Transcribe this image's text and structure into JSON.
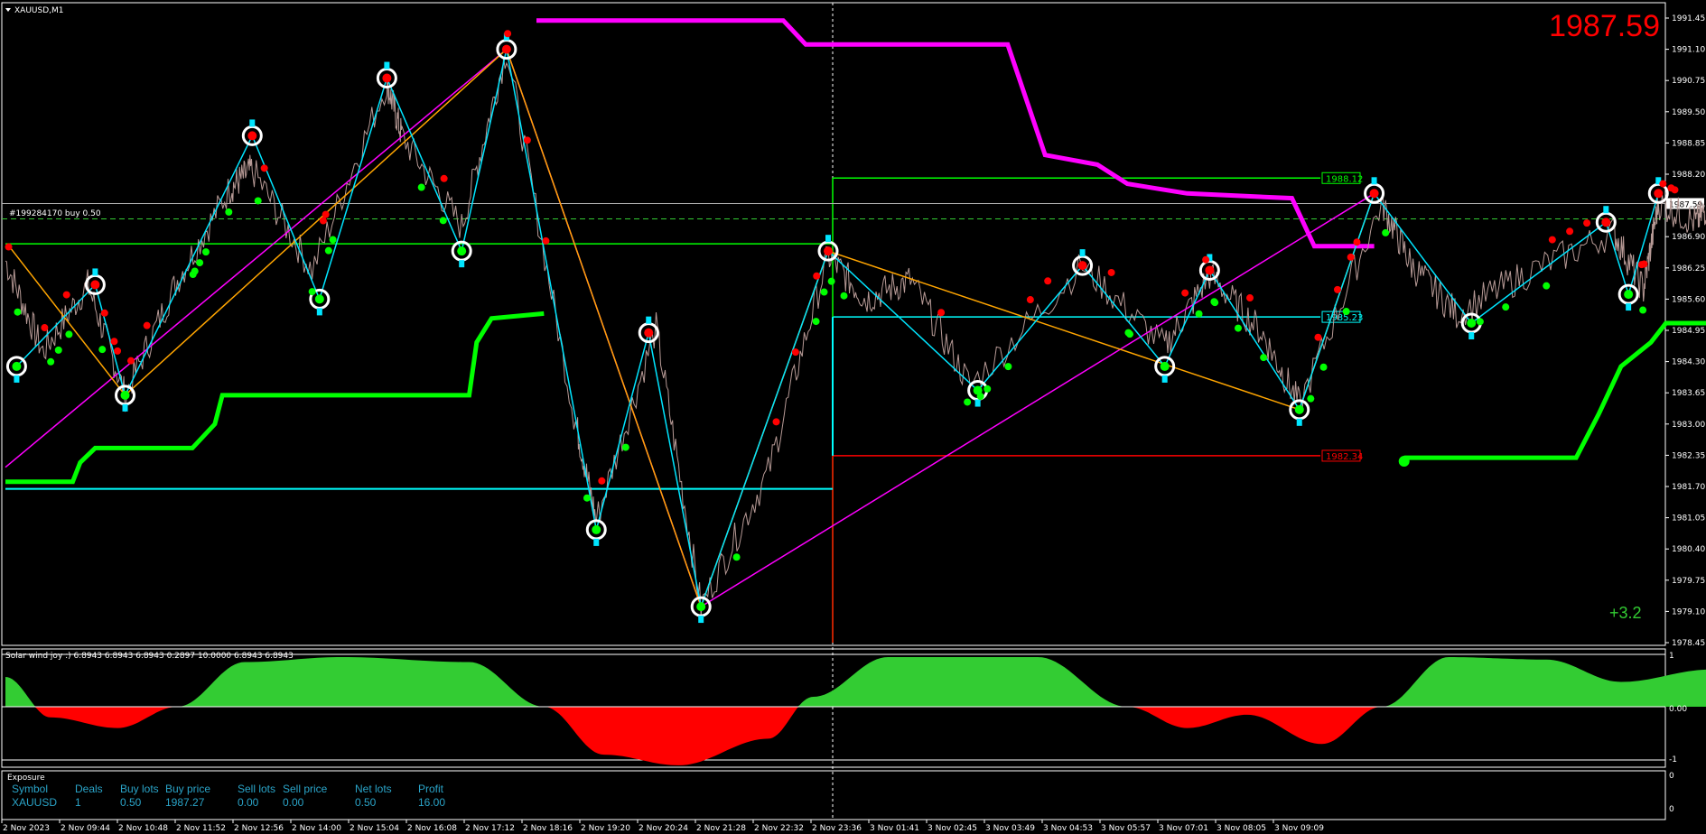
{
  "window": {
    "symbol_title": "XAUUSD,M1"
  },
  "price_display": "1987.59",
  "order_label": "#199284170 buy 0.50",
  "profit_display": "+3.2",
  "levels": {
    "green": {
      "label": "1988.12",
      "value": 1988.12,
      "color": "#00ff00"
    },
    "cyan": {
      "label": "1985.23",
      "value": 1985.23,
      "color": "#00ffff"
    },
    "red": {
      "label": "1982.34",
      "value": 1982.34,
      "color": "#ff0000"
    },
    "current": {
      "label": "1987.59",
      "value": 1987.59
    }
  },
  "indicator": {
    "title": "Solar wind joy :) 6.8943 6.8943 6.8943 0.2897 10.0000 6.8943 6.8943"
  },
  "indicator_axis": [
    "1",
    "0.00",
    "-1"
  ],
  "exposure": {
    "title": "Exposure",
    "headers": [
      "Symbol",
      "Deals",
      "Buy lots",
      "Buy price",
      "Sell lots",
      "Sell price",
      "Net lots",
      "Profit"
    ],
    "row": [
      "XAUUSD",
      "1",
      "0.50",
      "1987.27",
      "0.00",
      "0.00",
      "0.50",
      "16.00"
    ]
  },
  "exposure_axis": [
    "0",
    "0"
  ],
  "colors": {
    "price_line": "#b79a96",
    "magenta": "#ff00ff",
    "orange": "#ffa500",
    "cyan": "#00e5ff",
    "green": "#00ff00",
    "red": "#ff0000",
    "osc_pos": "#33cc33",
    "osc_neg": "#ff0000"
  },
  "chart_data": {
    "type": "line",
    "title": "XAUUSD,M1",
    "xlabels": [
      "2 Nov 2023",
      "2 Nov 09:44",
      "2 Nov 10:48",
      "2 Nov 11:52",
      "2 Nov 12:56",
      "2 Nov 14:00",
      "2 Nov 15:04",
      "2 Nov 16:08",
      "2 Nov 17:12",
      "2 Nov 18:16",
      "2 Nov 19:20",
      "2 Nov 20:24",
      "2 Nov 21:28",
      "2 Nov 22:32",
      "2 Nov 23:36",
      "3 Nov 01:41",
      "3 Nov 02:45",
      "3 Nov 03:49",
      "3 Nov 04:53",
      "3 Nov 05:57",
      "3 Nov 07:01",
      "3 Nov 08:05",
      "3 Nov 09:09"
    ],
    "yticks": [
      "1991.45",
      "1991.10",
      "1990.75",
      "1989.50",
      "1988.85",
      "1988.20",
      "1987.55",
      "1986.90",
      "1986.25",
      "1985.60",
      "1984.95",
      "1984.30",
      "1983.65",
      "1983.00",
      "1982.35",
      "1981.70",
      "1981.05",
      "1980.40",
      "1979.75",
      "1979.10",
      "1978.45"
    ],
    "ylim": [
      1978.45,
      1991.45
    ],
    "price_path": [
      {
        "t": 0,
        "p": 1986.4
      },
      {
        "t": 0.5,
        "p": 1984.5
      },
      {
        "t": 1.1,
        "p": 1985.9
      },
      {
        "t": 1.6,
        "p": 1983.6
      },
      {
        "t": 2.3,
        "p": 1986.0
      },
      {
        "t": 3.0,
        "p": 1987.9
      },
      {
        "t": 3.3,
        "p": 1988.3
      },
      {
        "t": 4.1,
        "p": 1986.2
      },
      {
        "t": 5.1,
        "p": 1990.1
      },
      {
        "t": 5.3,
        "p": 1989.0
      },
      {
        "t": 6.1,
        "p": 1987.1
      },
      {
        "t": 6.7,
        "p": 1990.8
      },
      {
        "t": 7.6,
        "p": 1983.2
      },
      {
        "t": 7.9,
        "p": 1981.0
      },
      {
        "t": 8.7,
        "p": 1985.0
      },
      {
        "t": 9.3,
        "p": 1979.2
      },
      {
        "t": 10.2,
        "p": 1982.0
      },
      {
        "t": 11.0,
        "p": 1986.5
      },
      {
        "t": 11.5,
        "p": 1985.6
      },
      {
        "t": 12.1,
        "p": 1986.0
      },
      {
        "t": 12.9,
        "p": 1983.8
      },
      {
        "t": 14.4,
        "p": 1986.3
      },
      {
        "t": 15.5,
        "p": 1984.6
      },
      {
        "t": 16.1,
        "p": 1986.1
      },
      {
        "t": 16.8,
        "p": 1984.9
      },
      {
        "t": 17.3,
        "p": 1983.4
      },
      {
        "t": 18.4,
        "p": 1987.6
      },
      {
        "t": 18.8,
        "p": 1986.3
      },
      {
        "t": 19.4,
        "p": 1985.3
      },
      {
        "t": 20.3,
        "p": 1986.1
      },
      {
        "t": 21.5,
        "p": 1987.0
      },
      {
        "t": 21.9,
        "p": 1985.8
      },
      {
        "t": 22.1,
        "p": 1987.6
      },
      {
        "t": 22.6,
        "p": 1987.2
      },
      {
        "t": 22.8,
        "p": 1987.6
      }
    ],
    "zigzag_cyan": [
      {
        "t": 0.15,
        "p": 1984.2
      },
      {
        "t": 1.2,
        "p": 1985.9
      },
      {
        "t": 1.6,
        "p": 1983.6
      },
      {
        "t": 3.3,
        "p": 1989.0
      },
      {
        "t": 4.2,
        "p": 1985.6
      },
      {
        "t": 5.1,
        "p": 1990.2
      },
      {
        "t": 6.1,
        "p": 1986.6
      },
      {
        "t": 6.7,
        "p": 1990.8
      },
      {
        "t": 7.9,
        "p": 1980.8
      },
      {
        "t": 8.6,
        "p": 1984.9
      },
      {
        "t": 9.3,
        "p": 1979.2
      },
      {
        "t": 11.0,
        "p": 1986.6
      },
      {
        "t": 13.0,
        "p": 1983.7
      },
      {
        "t": 14.4,
        "p": 1986.3
      },
      {
        "t": 15.5,
        "p": 1984.2
      },
      {
        "t": 16.1,
        "p": 1986.2
      },
      {
        "t": 17.3,
        "p": 1983.3
      },
      {
        "t": 18.3,
        "p": 1987.8
      },
      {
        "t": 19.6,
        "p": 1985.1
      },
      {
        "t": 21.4,
        "p": 1987.2
      },
      {
        "t": 21.7,
        "p": 1985.7
      },
      {
        "t": 22.1,
        "p": 1987.8
      }
    ],
    "zigzag_orange": [
      {
        "t": 0.05,
        "p": 1986.7
      },
      {
        "t": 1.6,
        "p": 1983.6
      },
      {
        "t": 6.7,
        "p": 1990.8
      },
      {
        "t": 9.3,
        "p": 1979.2
      },
      {
        "t": 11.0,
        "p": 1986.6
      },
      {
        "t": 17.3,
        "p": 1983.3
      },
      {
        "t": 18.3,
        "p": 1987.8
      }
    ],
    "zigzag_magenta": [
      {
        "t": 0,
        "p": 1982.1
      },
      {
        "t": 6.7,
        "p": 1990.8
      },
      {
        "t": 9.3,
        "p": 1979.2
      },
      {
        "t": 18.3,
        "p": 1987.8
      }
    ],
    "magenta_step": [
      {
        "t": 7.1,
        "p": 1991.4
      },
      {
        "t": 10.4,
        "p": 1991.4
      },
      {
        "t": 10.7,
        "p": 1990.9
      },
      {
        "t": 13.4,
        "p": 1990.9
      },
      {
        "t": 13.9,
        "p": 1988.6
      },
      {
        "t": 14.6,
        "p": 1988.4
      },
      {
        "t": 15.0,
        "p": 1988.0
      },
      {
        "t": 15.8,
        "p": 1987.8
      },
      {
        "t": 17.2,
        "p": 1987.7
      },
      {
        "t": 17.5,
        "p": 1986.7
      },
      {
        "t": 18.3,
        "p": 1986.7
      }
    ],
    "green_step": [
      {
        "t": 0,
        "p": 1981.8
      },
      {
        "t": 0.9,
        "p": 1981.8
      },
      {
        "t": 1.0,
        "p": 1982.2
      },
      {
        "t": 1.2,
        "p": 1982.5
      },
      {
        "t": 2.5,
        "p": 1982.5
      },
      {
        "t": 2.8,
        "p": 1983.0
      },
      {
        "t": 2.9,
        "p": 1983.6
      },
      {
        "t": 6.2,
        "p": 1983.6
      },
      {
        "t": 6.3,
        "p": 1984.7
      },
      {
        "t": 6.5,
        "p": 1985.2
      },
      {
        "t": 7.2,
        "p": 1985.3
      }
    ],
    "green_step_b": [
      {
        "t": 18.7,
        "p": 1982.3
      },
      {
        "t": 21.0,
        "p": 1982.3
      },
      {
        "t": 21.3,
        "p": 1983.2
      },
      {
        "t": 21.6,
        "p": 1984.2
      },
      {
        "t": 22.0,
        "p": 1984.7
      },
      {
        "t": 22.2,
        "p": 1985.1
      },
      {
        "t": 22.8,
        "p": 1985.1
      }
    ],
    "oscillator": [
      {
        "t": 0,
        "v": 0.6
      },
      {
        "t": 0.6,
        "v": -0.2
      },
      {
        "t": 1.5,
        "v": -0.4
      },
      {
        "t": 2.3,
        "v": 0.0
      },
      {
        "t": 3.2,
        "v": 0.9
      },
      {
        "t": 4.5,
        "v": 1.0
      },
      {
        "t": 6.2,
        "v": 0.9
      },
      {
        "t": 7.2,
        "v": 0.0
      },
      {
        "t": 8.0,
        "v": -0.9
      },
      {
        "t": 9.0,
        "v": -1.1
      },
      {
        "t": 10.2,
        "v": -0.6
      },
      {
        "t": 10.8,
        "v": 0.2
      },
      {
        "t": 11.8,
        "v": 1.0
      },
      {
        "t": 13.8,
        "v": 1.0
      },
      {
        "t": 15.0,
        "v": 0.0
      },
      {
        "t": 15.8,
        "v": -0.4
      },
      {
        "t": 16.6,
        "v": -0.15
      },
      {
        "t": 17.6,
        "v": -0.7
      },
      {
        "t": 18.4,
        "v": 0.0
      },
      {
        "t": 19.3,
        "v": 1.0
      },
      {
        "t": 20.6,
        "v": 0.95
      },
      {
        "t": 21.6,
        "v": 0.5
      },
      {
        "t": 22.8,
        "v": 0.75
      }
    ],
    "y_ticks_osc": [
      1,
      0,
      -1
    ]
  }
}
